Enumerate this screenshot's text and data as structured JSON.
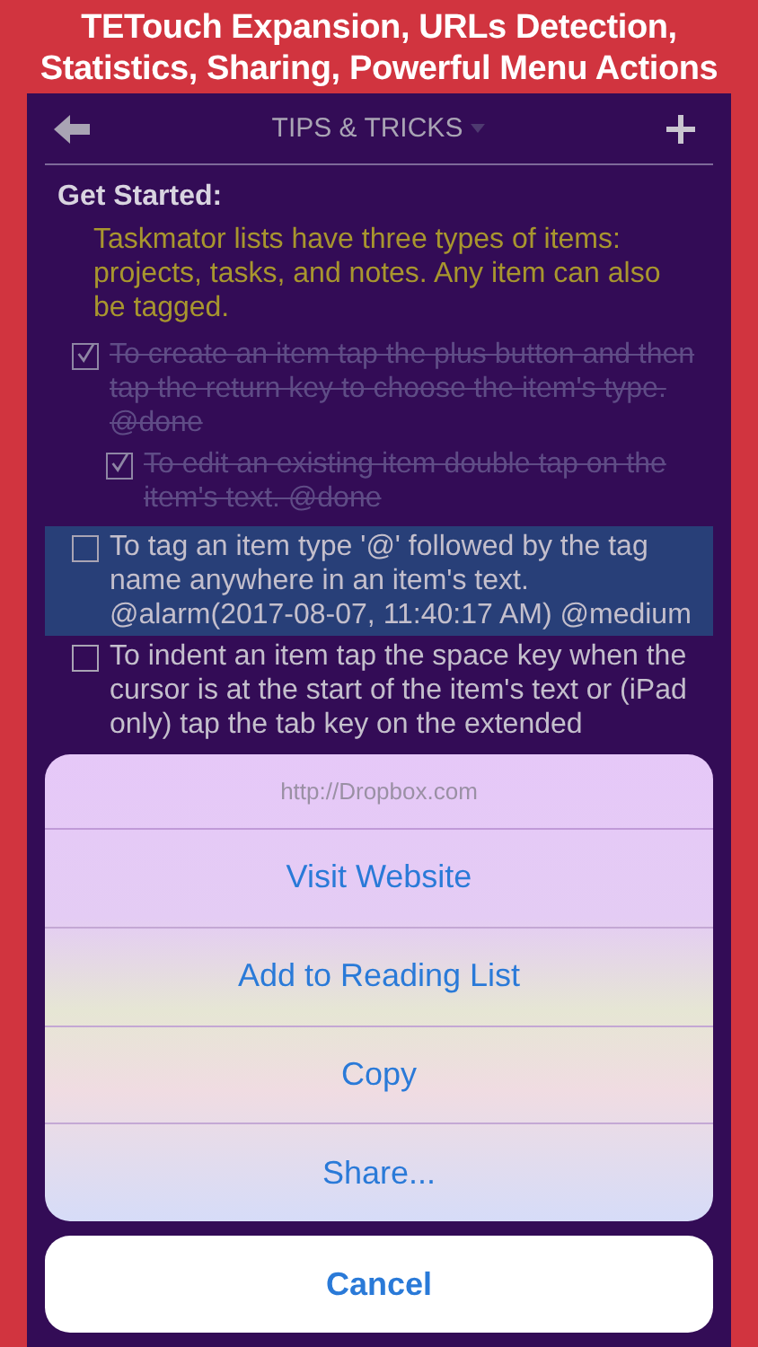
{
  "banner": {
    "lines": [
      "TETouch Expansion, URLs Detection,",
      "Statistics, Sharing, Powerful Menu Actions"
    ]
  },
  "nav": {
    "title": "TIPS & TRICKS"
  },
  "items": [
    {
      "kind": "heading",
      "text": "Get Started:"
    },
    {
      "kind": "note",
      "text": "Taskmator lists have three types of items: projects, tasks, and notes. Any item can also be tagged."
    },
    {
      "kind": "task",
      "checked": true,
      "selected": false,
      "text": "To create an item tap the plus button and then tap the return key to choose the item's type. @done",
      "children": [
        {
          "kind": "task",
          "checked": true,
          "selected": false,
          "text": "To edit an existing item double tap on the item's text. @done"
        }
      ]
    },
    {
      "kind": "task",
      "checked": false,
      "selected": true,
      "text": "To tag an item type '@' followed by the tag name anywhere in an item's text. @alarm(2017-08-07, 11:40:17 AM) @medium"
    },
    {
      "kind": "task",
      "checked": false,
      "selected": false,
      "text": "To indent an item tap the space key when the cursor is at the start of the item's text or (iPad only) tap the tab key on the extended"
    }
  ],
  "action_sheet": {
    "title": "http://Dropbox.com",
    "actions": [
      {
        "label": "Visit Website"
      },
      {
        "label": "Add to Reading List"
      },
      {
        "label": "Copy"
      },
      {
        "label": "Share..."
      }
    ],
    "cancel": "Cancel"
  }
}
